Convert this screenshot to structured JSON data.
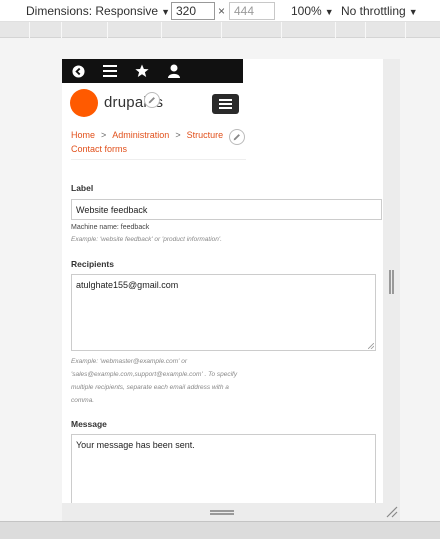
{
  "devtools": {
    "dimensions_label": "Dimensions: Responsive",
    "width": "320",
    "height_placeholder": "444",
    "times": "×",
    "zoom": "100%",
    "throttling": "No throttling",
    "caret": "▼"
  },
  "toolbar": {
    "items": [
      "back-icon",
      "menu-icon",
      "star-icon",
      "user-icon",
      "pencil-icon"
    ]
  },
  "site": {
    "name": "drupal8s",
    "logo_color": "#ff5a00"
  },
  "breadcrumb": {
    "items": [
      "Home",
      "Administration",
      "Structure",
      "Contact forms"
    ],
    "separator": ">",
    "link_color": "#e1501b"
  },
  "form": {
    "label": {
      "title": "Label",
      "value": "Website feedback",
      "machine_name": "Machine name: feedback",
      "hint": "Example: 'website feedback' or 'product information'."
    },
    "recipients": {
      "title": "Recipients",
      "value": "atulghate155@gmail.com",
      "hint_lines": [
        "Example: 'webmaster@example.com' or",
        "'sales@example.com,support@example.com' . To specify",
        "multiple recipients, separate each email address with a",
        "comma."
      ]
    },
    "message": {
      "title": "Message",
      "value": "Your message has been sent."
    }
  }
}
